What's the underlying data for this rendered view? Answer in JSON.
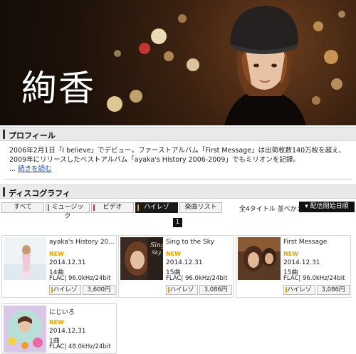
{
  "banner": {
    "artist_name": "絢香"
  },
  "profile": {
    "heading": "プロフィール",
    "text": "2006年2月1日「I believe」でデビュー。ファーストアルバム「First Message」は出荷枚数140万枚を超え、2009年にリリースしたベストアルバム「ayaka's History 2006-2009」でもミリオンを記録。",
    "more_prefix": "...",
    "more_link": "続きを読む"
  },
  "discography": {
    "heading": "ディスコグラフィ",
    "tabs": [
      {
        "label": "すべて",
        "mark": ""
      },
      {
        "label": "ミュージック",
        "mark": "#9b59b6"
      },
      {
        "label": "ビデオ",
        "mark": "#c0392b"
      },
      {
        "label": "ハイレゾ",
        "mark": "#e1a100"
      },
      {
        "label": "楽曲リスト",
        "mark": ""
      }
    ],
    "active_tab": "ハイレゾ",
    "sort_label": "全4タイトル 並べかえ：",
    "sort_button": "▾ 配信開始日順",
    "page": "1",
    "albums": [
      {
        "title": "ayaka's History 20…",
        "badge": "NEW",
        "date": "2014.12.31",
        "tracks": "14曲",
        "format": "FLAC| 96.0kHz/24bit",
        "type": "ハイレゾ",
        "price": "3,600円"
      },
      {
        "title": "Sing to the Sky",
        "badge": "NEW",
        "date": "2014.12.31",
        "tracks": "15曲",
        "format": "FLAC| 96.0kHz/24bit",
        "type": "ハイレゾ",
        "price": "3,086円"
      },
      {
        "title": "First Message",
        "badge": "NEW",
        "date": "2014.12.31",
        "tracks": "15曲",
        "format": "FLAC| 96.0kHz/24bit",
        "type": "ハイレゾ",
        "price": "3,086円"
      },
      {
        "title": "にじいろ",
        "badge": "NEW",
        "date": "2014.12.31",
        "tracks": "1曲",
        "format": "FLAC| 48.0kHz/24bit",
        "type": "",
        "price": ""
      }
    ]
  },
  "colors": {
    "accent_new": "#e1a100",
    "hires_mark": "#e1a100",
    "active_tab_bg": "#1a1a1a"
  }
}
